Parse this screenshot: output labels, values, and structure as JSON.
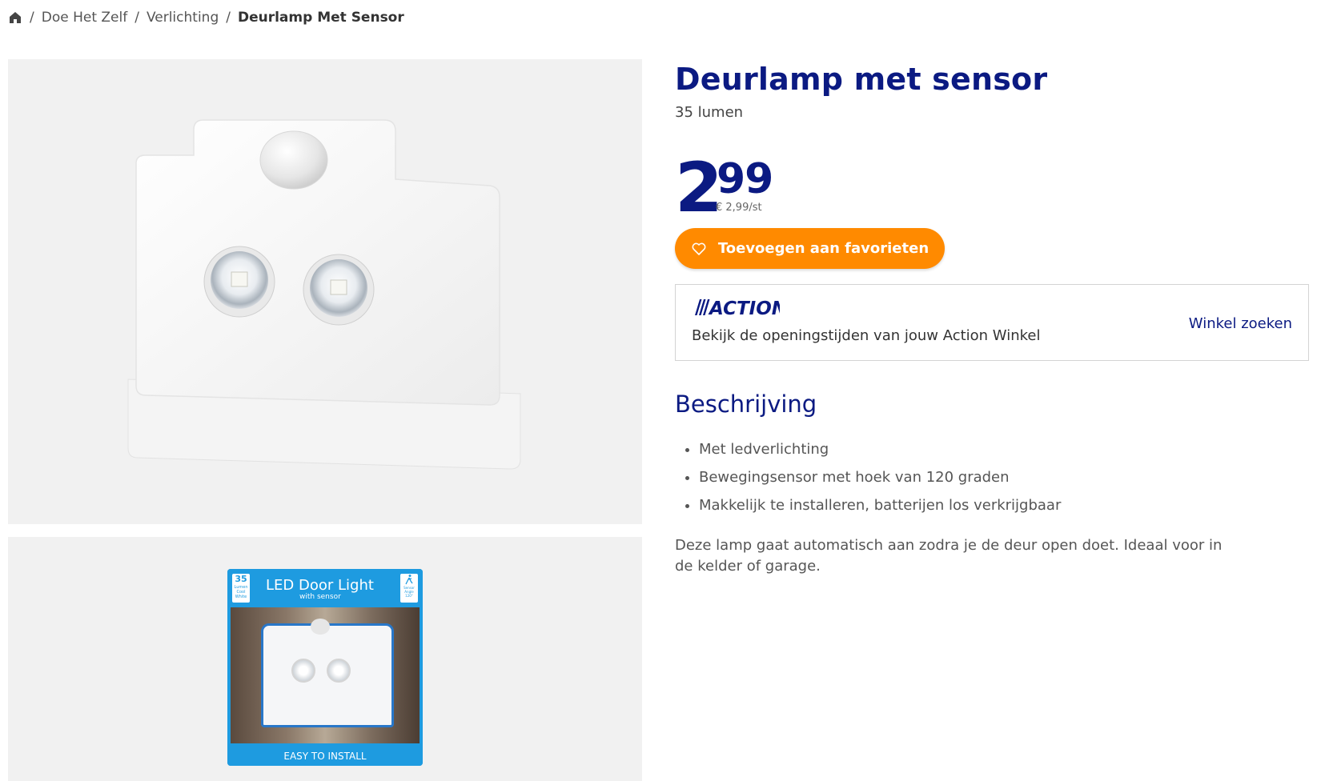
{
  "breadcrumb": {
    "items": [
      "Doe Het Zelf",
      "Verlichting"
    ],
    "current": "Deurlamp Met Sensor"
  },
  "product": {
    "title": "Deurlamp met sensor",
    "subtitle": "35 lumen",
    "price_int": "2",
    "price_dec": "99",
    "unit_price": "€ 2,99/st"
  },
  "favorite_button": {
    "label": "Toevoegen aan favorieten"
  },
  "store": {
    "logo_text": "ACTION",
    "text": "Bekijk de openingstijden van jouw Action Winkel",
    "link": "Winkel zoeken"
  },
  "description": {
    "heading": "Beschrijving",
    "bullets": [
      "Met ledverlichting",
      "Bewegingsensor met hoek van 120 graden",
      "Makkelijk te installeren, batterijen los verkrijgbaar"
    ],
    "text": "Deze lamp gaat automatisch aan zodra je de deur open doet. Ideaal voor in de kelder of garage."
  },
  "package": {
    "lumen": "35",
    "lumen_unit": "Lumen",
    "color_label": "Cool White",
    "title": "LED Door Light",
    "subtitle": "with sensor",
    "sensor_label": "Sensor Angle 120°",
    "footer": "EASY TO INSTALL"
  },
  "colors": {
    "brand_blue": "#0b1a82",
    "orange": "#ff8a00",
    "image_bg": "#f1f1f1",
    "package_blue": "#1e9be0"
  }
}
